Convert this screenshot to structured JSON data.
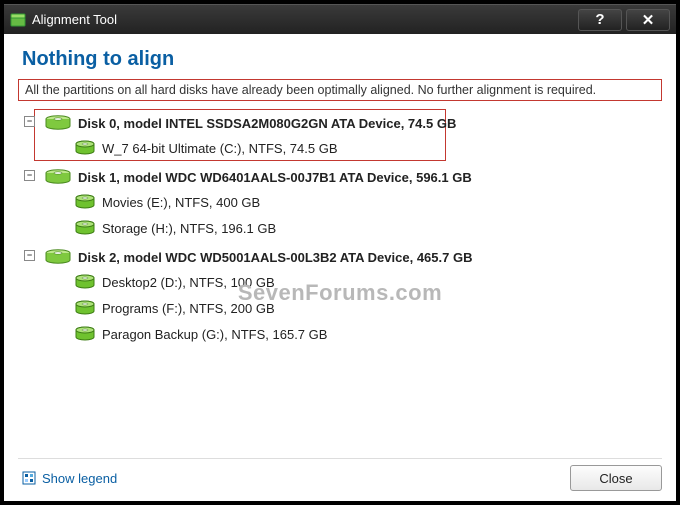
{
  "window": {
    "title": "Alignment Tool"
  },
  "heading": "Nothing to align",
  "info": "All the partitions on all hard disks have already been optimally aligned. No further alignment is required.",
  "disks": [
    {
      "expander": "−",
      "label": "Disk 0, model INTEL SSDSA2M080G2GN ATA Device, 74.5 GB",
      "partitions": [
        {
          "label": "W_7 64-bit Ultimate (C:), NTFS, 74.5 GB"
        }
      ]
    },
    {
      "expander": "−",
      "label": "Disk 1, model WDC WD6401AALS-00J7B1 ATA Device, 596.1 GB",
      "partitions": [
        {
          "label": "Movies (E:), NTFS, 400 GB"
        },
        {
          "label": "Storage (H:), NTFS, 196.1 GB"
        }
      ]
    },
    {
      "expander": "−",
      "label": "Disk 2, model WDC WD5001AALS-00L3B2 ATA Device, 465.7 GB",
      "partitions": [
        {
          "label": "Desktop2 (D:), NTFS, 100 GB"
        },
        {
          "label": "Programs (F:), NTFS, 200 GB"
        },
        {
          "label": "Paragon Backup (G:), NTFS, 165.7 GB"
        }
      ]
    }
  ],
  "legend": "Show legend",
  "close_label": "Close",
  "watermark": "SevenForums.com"
}
